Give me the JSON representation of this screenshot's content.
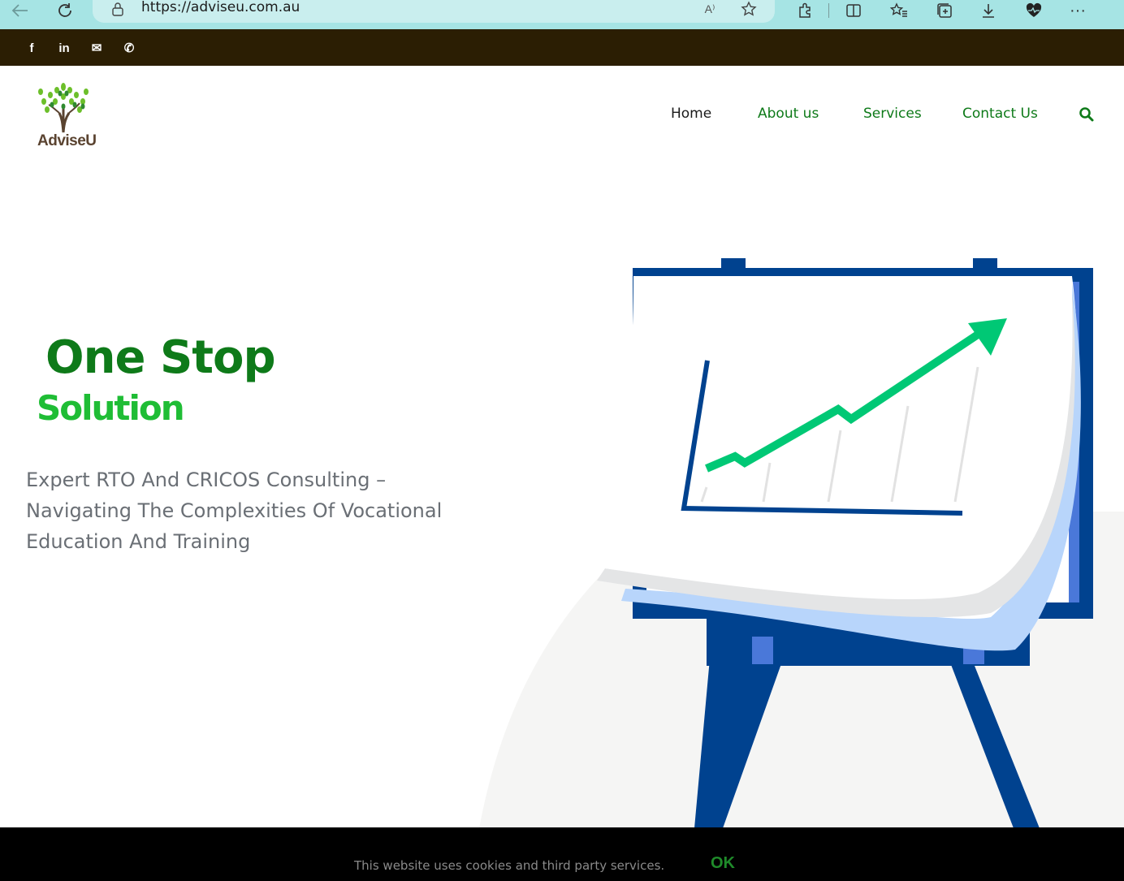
{
  "browser": {
    "url": "https://adviseu.com.au"
  },
  "topbar": {
    "social": [
      {
        "icon": "facebook-icon",
        "glyph": "f"
      },
      {
        "icon": "linkedin-icon",
        "glyph": "in"
      },
      {
        "icon": "mail-icon",
        "glyph": "✉"
      },
      {
        "icon": "phone-icon",
        "glyph": "✆"
      }
    ]
  },
  "header": {
    "brand": "AdviseU",
    "nav": [
      {
        "label": "Home",
        "color": "#1a1a1a"
      },
      {
        "label": "About us",
        "color": "#0e7a19"
      },
      {
        "label": "Services",
        "color": "#0e7a19"
      },
      {
        "label": "Contact Us",
        "color": "#0e7a19"
      }
    ],
    "search_icon": "search-icon"
  },
  "hero": {
    "title_line1": "One Stop",
    "title_line2": "Solution",
    "subtitle": "Expert RTO And CRICOS Consulting – Navigating The Complexities Of Vocational Education And Training"
  },
  "cookie": {
    "message": "This website uses cookies and third party services.",
    "ok_label": "OK"
  },
  "colors": {
    "accent_dark_green": "#0e7a19",
    "accent_light_green": "#1fbd35",
    "topbar_bg": "#2b1e03",
    "browser_bg": "#a6e4e4",
    "navy": "#00428f",
    "arrow_green": "#00c875"
  }
}
